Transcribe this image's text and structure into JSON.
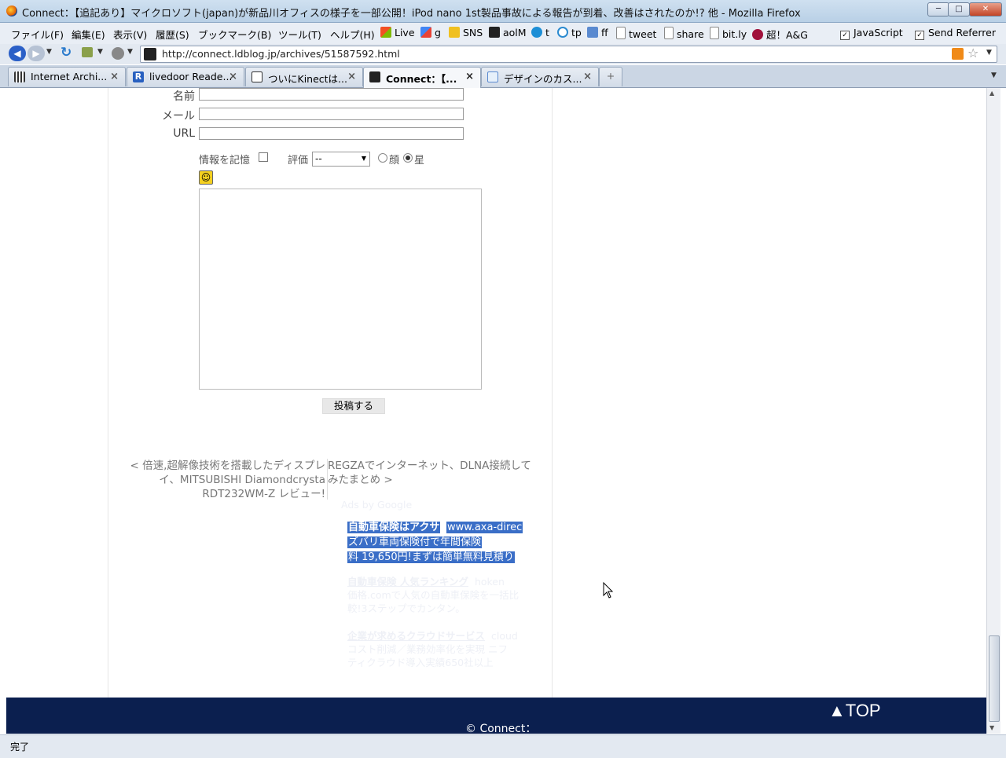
{
  "window": {
    "title": "Connect：【追記あり】マイクロソフト(japan)が新品川オフィスの様子を一部公開！iPod nano 1st製品事故による報告が到着、改善はされたのか!? 他 - Mozilla Firefox",
    "minimize": "─",
    "maximize": "□",
    "close": "✕"
  },
  "menubar": {
    "items": [
      "ファイル(F)",
      "編集(E)",
      "表示(V)",
      "履歴(S)",
      "ブックマーク(B)",
      "ツール(T)",
      "ヘルプ(H)"
    ],
    "bookmarks": [
      "Live",
      "g",
      "SNS",
      "aolM",
      "t",
      "tp",
      "ff",
      "tweet",
      "share",
      "bit.ly",
      "超！A&G"
    ],
    "toggles": [
      "JavaScript",
      "Send Referrer"
    ]
  },
  "navbar": {
    "url": "http://connect.ldblog.jp/archives/51587592.html"
  },
  "tabs": [
    {
      "label": "Internet Archi...",
      "active": false
    },
    {
      "label": "livedoor Reade...",
      "active": false
    },
    {
      "label": "ついにKinectは...",
      "active": false
    },
    {
      "label": "Connect：【...",
      "active": true
    },
    {
      "label": "デザインのカス...",
      "active": false
    }
  ],
  "tab_close": "×",
  "new_tab": "+",
  "form": {
    "name_label": "名前",
    "mail_label": "メール",
    "url_label": "URL",
    "remember_label": "情報を記憶",
    "rating_label": "評価",
    "rating_value": "--",
    "radio_face": "顔",
    "radio_star": "星",
    "submit_label": "投稿する"
  },
  "post_nav": {
    "prev": "< 倍速,超解像技術を搭載したディスプレイ、MITSUBISHI Diamondcrysta RDT232WM-Z レビュー!",
    "next": "REGZAでインターネット、DLNA接続してみたまとめ >"
  },
  "ads": {
    "ads_by": "Ads by Google",
    "ad1_title": "自動車保険はアクサ",
    "ad1_url": "www.axa-direc",
    "ad1_line1": "ズバリ車両保険付で年間保険",
    "ad1_line2": "料 19,650円!まずは簡単無料見積り",
    "ad2_title": "自動車保険 人気ランキング",
    "ad2_url": "hoken",
    "ad2_line1": "価格.comで人気の自動車保険を一括比",
    "ad2_line2": "較!3ステップでカンタン。",
    "ad3_title": "企業が求めるクラウドサービス",
    "ad3_url": "cloud",
    "ad3_line1": "コスト削減／業務効率化を実現 ニフ",
    "ad3_line2": "ティクラウド導入実績650社以上"
  },
  "footer": {
    "top_label": "▲TOP",
    "copyright": "© Connect："
  },
  "status": {
    "text": "完了"
  }
}
